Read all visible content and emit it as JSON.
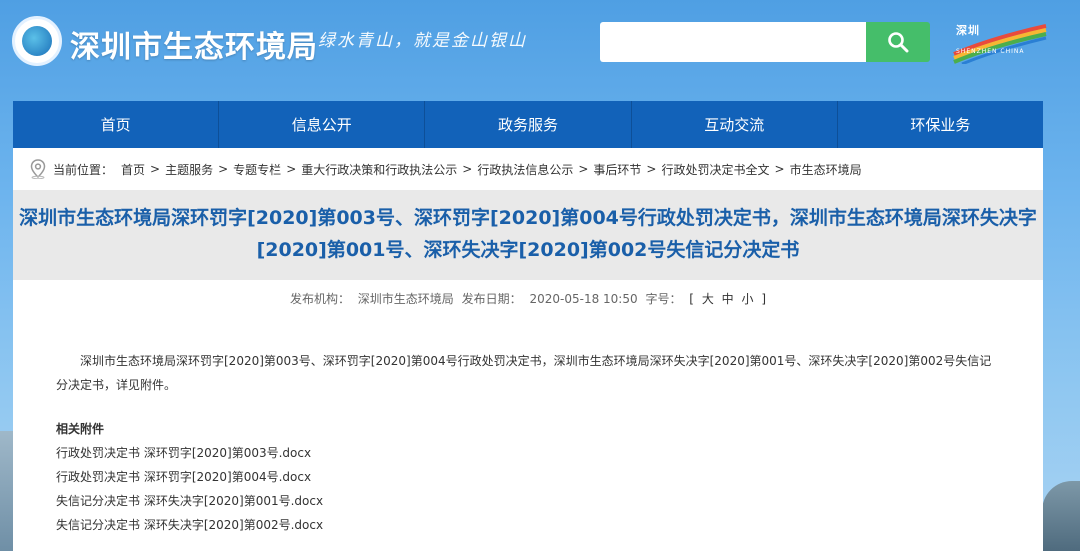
{
  "header": {
    "site_title": "深圳市生态环境局",
    "slogan": "绿水青山，就是金山银山",
    "search": {
      "placeholder": "",
      "button_icon": "search-icon"
    },
    "brand_text": "深圳",
    "brand_sub": "SHENZHEN CHINA"
  },
  "nav": {
    "items": [
      {
        "label": "首页"
      },
      {
        "label": "信息公开"
      },
      {
        "label": "政务服务"
      },
      {
        "label": "互动交流"
      },
      {
        "label": "环保业务"
      }
    ]
  },
  "breadcrumb": {
    "prefix": "当前位置：",
    "items": [
      "首页",
      "主题服务",
      "专题专栏",
      "重大行政决策和行政执法公示",
      "行政执法信息公示",
      "事后环节",
      "行政处罚决定书全文",
      "市生态环境局"
    ],
    "separator": ">"
  },
  "article": {
    "title": "深圳市生态环境局深环罚字[2020]第003号、深环罚字[2020]第004号行政处罚决定书，深圳市生态环境局深环失决字[2020]第001号、深环失决字[2020]第002号失信记分决定书",
    "meta": {
      "publisher_label": "发布机构：",
      "publisher": "深圳市生态环境局",
      "date_label": "发布日期：",
      "date": "2020-05-18 10:50",
      "font_label": "字号：",
      "bracket_open": "[",
      "sizes": [
        "大",
        "中",
        "小"
      ],
      "bracket_close": "]"
    },
    "paragraph": "深圳市生态环境局深环罚字[2020]第003号、深环罚字[2020]第004号行政处罚决定书，深圳市生态环境局深环失决字[2020]第001号、深环失决字[2020]第002号失信记分决定书，详见附件。",
    "attachments_title": "相关附件",
    "attachments": [
      "行政处罚决定书 深环罚字[2020]第003号.docx",
      "行政处罚决定书 深环罚字[2020]第004号.docx",
      "失信记分决定书 深环失决字[2020]第001号.docx",
      "失信记分决定书 深环失决字[2020]第002号.docx"
    ]
  },
  "colors": {
    "nav_bg": "#1262b9",
    "title": "#1a5fa9",
    "search_button": "#45be6a"
  }
}
